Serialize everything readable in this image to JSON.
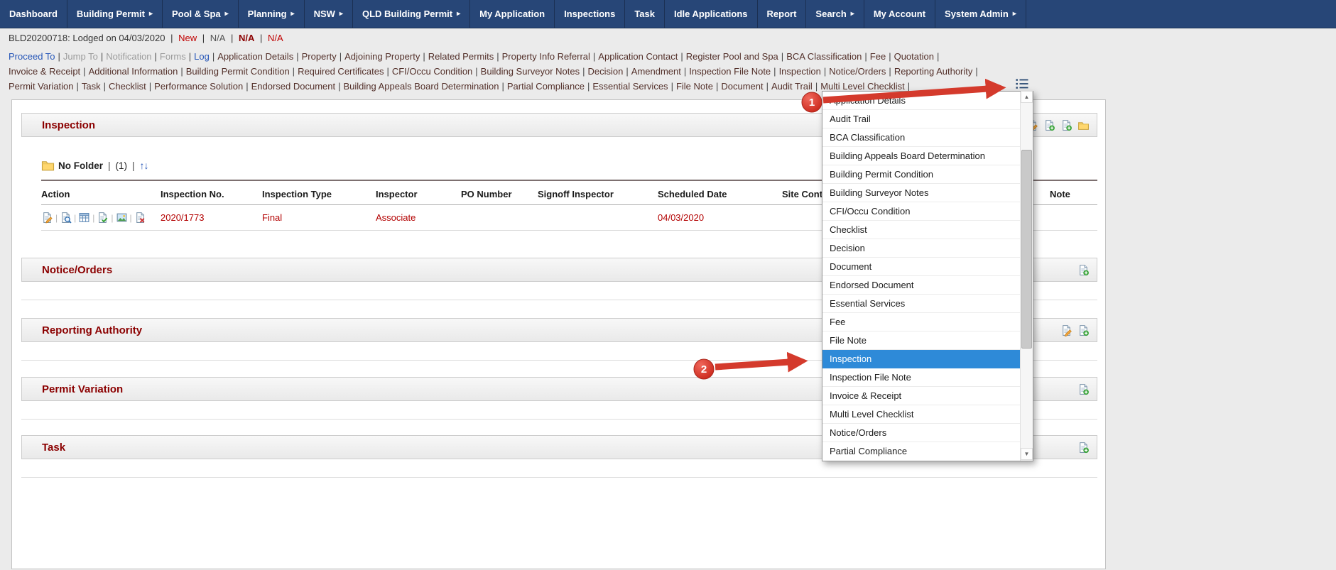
{
  "ui": {
    "separator": "|"
  },
  "colors": {
    "nav_background": "#274677",
    "section_title_maroon": "#8b0000",
    "table_value_red": "#b30000",
    "dropdown_selected_blue": "#2e8ad8",
    "annotation_red": "#d43a2c"
  },
  "nav": {
    "items": [
      {
        "label": "Dashboard",
        "has_submenu": false
      },
      {
        "label": "Building Permit",
        "has_submenu": true
      },
      {
        "label": "Pool & Spa",
        "has_submenu": true
      },
      {
        "label": "Planning",
        "has_submenu": true
      },
      {
        "label": "NSW",
        "has_submenu": true
      },
      {
        "label": "QLD Building Permit",
        "has_submenu": true
      },
      {
        "label": "My Application",
        "has_submenu": false
      },
      {
        "label": "Inspections",
        "has_submenu": false
      },
      {
        "label": "Task",
        "has_submenu": false
      },
      {
        "label": "Idle Applications",
        "has_submenu": false
      },
      {
        "label": "Report",
        "has_submenu": false
      },
      {
        "label": "Search",
        "has_submenu": true
      },
      {
        "label": "My Account",
        "has_submenu": false
      },
      {
        "label": "System Admin",
        "has_submenu": true
      }
    ]
  },
  "status": {
    "prefix": "BLD20200718: Lodged on 04/03/2020",
    "values": [
      {
        "text": "New",
        "style": "red"
      },
      {
        "text": "N/A",
        "style": "plain"
      },
      {
        "text": "N/A",
        "style": "bold-maroon"
      },
      {
        "text": "N/A",
        "style": "red"
      }
    ]
  },
  "quick_links": {
    "menu_icon": "list-menu-icon",
    "rows": [
      [
        {
          "label": "Proceed To",
          "style": "blue"
        },
        {
          "label": "Jump To",
          "style": "gray"
        },
        {
          "label": "Notification",
          "style": "gray"
        },
        {
          "label": "Forms",
          "style": "gray"
        },
        {
          "label": "Log",
          "style": "blue"
        },
        {
          "label": "Application Details",
          "style": "dark"
        },
        {
          "label": "Property",
          "style": "dark"
        },
        {
          "label": "Adjoining Property",
          "style": "dark"
        },
        {
          "label": "Related Permits",
          "style": "dark"
        },
        {
          "label": "Property Info Referral",
          "style": "dark"
        },
        {
          "label": "Application Contact",
          "style": "dark"
        },
        {
          "label": "Register Pool and Spa",
          "style": "dark"
        },
        {
          "label": "BCA Classification",
          "style": "dark"
        },
        {
          "label": "Fee",
          "style": "dark"
        },
        {
          "label": "Quotation",
          "style": "dark"
        }
      ],
      [
        {
          "label": "Invoice & Receipt",
          "style": "dark"
        },
        {
          "label": "Additional Information",
          "style": "dark"
        },
        {
          "label": "Building Permit Condition",
          "style": "dark"
        },
        {
          "label": "Required Certificates",
          "style": "dark"
        },
        {
          "label": "CFI/Occu Condition",
          "style": "dark"
        },
        {
          "label": "Building Surveyor Notes",
          "style": "dark"
        },
        {
          "label": "Decision",
          "style": "dark"
        },
        {
          "label": "Amendment",
          "style": "dark"
        },
        {
          "label": "Inspection File Note",
          "style": "dark"
        },
        {
          "label": "Inspection",
          "style": "dark"
        },
        {
          "label": "Notice/Orders",
          "style": "dark"
        },
        {
          "label": "Reporting Authority",
          "style": "dark"
        }
      ],
      [
        {
          "label": "Permit Variation",
          "style": "dark"
        },
        {
          "label": "Task",
          "style": "dark"
        },
        {
          "label": "Checklist",
          "style": "dark"
        },
        {
          "label": "Performance Solution",
          "style": "dark"
        },
        {
          "label": "Endorsed Document",
          "style": "dark"
        },
        {
          "label": "Building Appeals Board Determination",
          "style": "dark"
        },
        {
          "label": "Partial Compliance",
          "style": "dark"
        },
        {
          "label": "Essential Services",
          "style": "dark"
        },
        {
          "label": "File Note",
          "style": "dark"
        },
        {
          "label": "Document",
          "style": "dark"
        },
        {
          "label": "Audit Trail",
          "style": "dark"
        },
        {
          "label": "Multi Level Checklist",
          "style": "dark"
        }
      ]
    ]
  },
  "sections": {
    "inspection": {
      "title": "Inspection",
      "header_icons": [
        "edit-document-icon",
        "add-document-icon",
        "add-document-icon",
        "folder-icon"
      ],
      "folder_bar": {
        "folder_icon": "small-folder-icon",
        "folder_label": "No Folder",
        "count": "(1)",
        "sort_icon": "sort-icon"
      },
      "table": {
        "headers": [
          "Action",
          "Inspection No.",
          "Inspection Type",
          "Inspector",
          "PO Number",
          "Signoff Inspector",
          "Scheduled Date",
          "Site Contact",
          "Note"
        ],
        "rows": [
          {
            "action_icons": [
              "edit-icon",
              "view-icon",
              "report-icon",
              "approve-icon",
              "photo-icon",
              "delete-icon"
            ],
            "cells": [
              "2020/1773",
              "Final",
              "Associate",
              "",
              "",
              "04/03/2020",
              "",
              ""
            ]
          }
        ]
      }
    },
    "notice_orders": {
      "title": "Notice/Orders",
      "header_icons": [
        "add-document-icon"
      ]
    },
    "reporting_authority": {
      "title": "Reporting Authority",
      "header_icons": [
        "edit-document-icon",
        "add-document-icon"
      ]
    },
    "permit_variation": {
      "title": "Permit Variation",
      "header_icons": [
        "add-document-icon"
      ]
    },
    "task": {
      "title": "Task",
      "header_icons": [
        "add-document-icon"
      ]
    }
  },
  "dropdown": {
    "items": [
      "Application Details",
      "Audit Trail",
      "BCA Classification",
      "Building Appeals Board Determination",
      "Building Permit Condition",
      "Building Surveyor Notes",
      "CFI/Occu Condition",
      "Checklist",
      "Decision",
      "Document",
      "Endorsed Document",
      "Essential Services",
      "Fee",
      "File Note",
      "Inspection",
      "Inspection File Note",
      "Invoice & Receipt",
      "Multi Level Checklist",
      "Notice/Orders",
      "Partial Compliance"
    ],
    "selected": "Inspection",
    "scrollbar": {
      "up": "▲",
      "down": "▼"
    }
  },
  "annotations": {
    "step1": "1",
    "step2": "2"
  }
}
